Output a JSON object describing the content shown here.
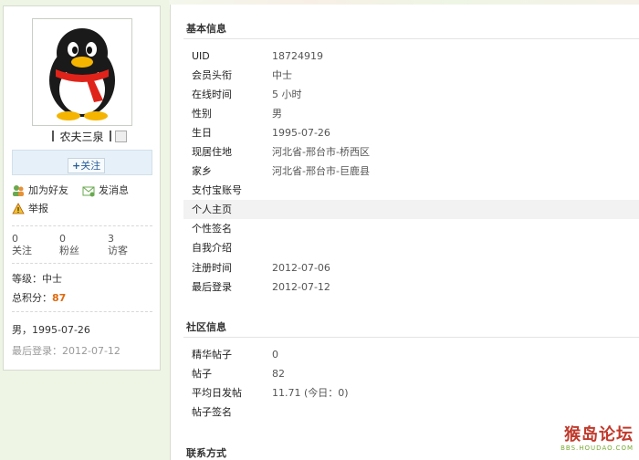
{
  "profile": {
    "name": "农夫三泉",
    "follow_label": "关注",
    "actions": {
      "add_friend": "加为好友",
      "send_message": "发消息",
      "report": "举报"
    },
    "stats": [
      {
        "value": "0",
        "label": "关注"
      },
      {
        "value": "0",
        "label": "粉丝"
      },
      {
        "value": "3",
        "label": "访客"
      }
    ],
    "level_label": "等级：",
    "level_value": "中士",
    "points_label": "总积分：",
    "points_value": "87",
    "gender_birthday": "男，1995-07-26",
    "last_login_label": "最后登录：",
    "last_login_value": "2012-07-12"
  },
  "basic_info": {
    "title": "基本信息",
    "rows": [
      {
        "key": "UID",
        "value": "18724919"
      },
      {
        "key": "会员头衔",
        "value": "中士"
      },
      {
        "key": "在线时间",
        "value": "5 小时"
      },
      {
        "key": "性别",
        "value": "男"
      },
      {
        "key": "生日",
        "value": "1995-07-26"
      },
      {
        "key": "现居住地",
        "value": "河北省-邢台市-桥西区"
      },
      {
        "key": "家乡",
        "value": "河北省-邢台市-巨鹿县"
      },
      {
        "key": "支付宝账号",
        "value": ""
      },
      {
        "key": "个人主页",
        "value": ""
      },
      {
        "key": "个性签名",
        "value": ""
      },
      {
        "key": "自我介绍",
        "value": ""
      },
      {
        "key": "注册时间",
        "value": "2012-07-06"
      },
      {
        "key": "最后登录",
        "value": "2012-07-12"
      }
    ]
  },
  "community_info": {
    "title": "社区信息",
    "rows": [
      {
        "key": "精华帖子",
        "value": "0"
      },
      {
        "key": "帖子",
        "value": "82"
      },
      {
        "key": "平均日发帖",
        "value": "11.71 (今日：0)"
      },
      {
        "key": "帖子签名",
        "value": ""
      }
    ]
  },
  "contact": {
    "title": "联系方式"
  },
  "watermark": {
    "brand": "猴岛论坛",
    "url": "BBS.HOUDAO.COM"
  },
  "colors": {
    "accent_orange": "#e16a0f",
    "link_blue": "#2a5f9a",
    "background": "#eef5e4"
  }
}
